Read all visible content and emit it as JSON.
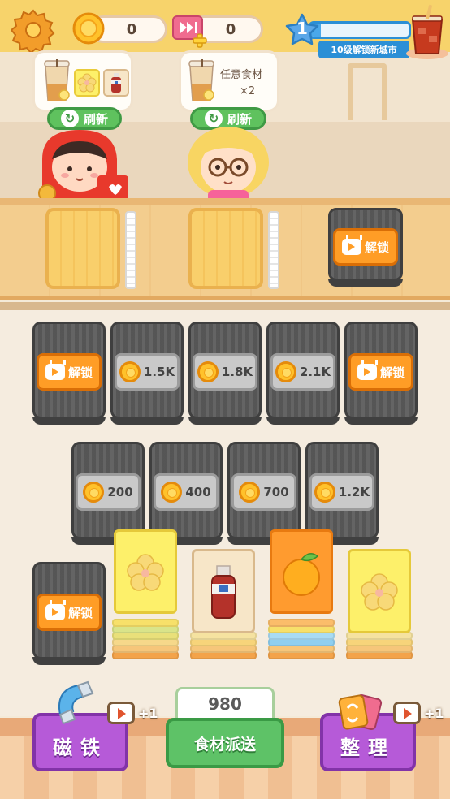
{
  "hud": {
    "coins": "0",
    "tickets": "0",
    "level": "1",
    "level_progress": 0.1,
    "level_caption": "10级解锁新城市",
    "icons": [
      "gear-icon",
      "coin-icon",
      "ticket-icon",
      "star-icon",
      "iced-drink-icon"
    ]
  },
  "orders": [
    {
      "items": [
        "bubble-tea-cup",
        "flower-card",
        "sauce-bottle-card"
      ],
      "refresh_label": "刷新"
    },
    {
      "items": [
        "bubble-tea-cup"
      ],
      "text": "任意食材",
      "multiplier": "×2",
      "refresh_label": "刷新"
    }
  ],
  "counter": {
    "unlock_label": "解锁"
  },
  "board": {
    "row1": [
      {
        "type": "unlock",
        "label": "解锁"
      },
      {
        "type": "price",
        "price": "1.5K"
      },
      {
        "type": "price",
        "price": "1.8K"
      },
      {
        "type": "price",
        "price": "2.1K"
      },
      {
        "type": "unlock",
        "label": "解锁"
      }
    ],
    "row2": [
      {
        "type": "price",
        "price": "200"
      },
      {
        "type": "price",
        "price": "400"
      },
      {
        "type": "price",
        "price": "700"
      },
      {
        "type": "price",
        "price": "1.2K"
      }
    ],
    "row3_unlock_label": "解锁",
    "stacks": [
      {
        "top_card": "flower",
        "color": "#fdf06a"
      },
      {
        "top_card": "sauce-bottle",
        "color": "#f7e6c8"
      },
      {
        "top_card": "orange",
        "color": "#ff9b2f"
      },
      {
        "top_card": "flower",
        "color": "#fdf06a"
      }
    ]
  },
  "controls": {
    "magnet_label": "磁铁",
    "sort_label": "整理",
    "ad_bonus": "+1",
    "deliver_count": "980",
    "deliver_label": "食材派送"
  }
}
